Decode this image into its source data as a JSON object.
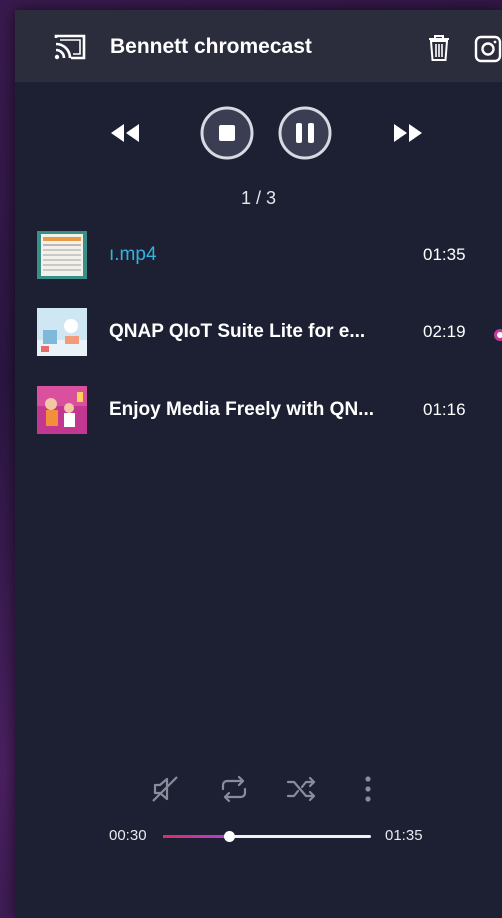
{
  "header": {
    "device_name": "Bennett chromecast",
    "icons": [
      "cast-icon",
      "trash-icon",
      "camera-icon"
    ]
  },
  "controls": {
    "icons": [
      "rewind-icon",
      "stop-icon",
      "pause-icon",
      "fast-forward-icon"
    ]
  },
  "playlist": {
    "counter": "1 / 3",
    "tracks": [
      {
        "title": "ı.mp4",
        "duration": "01:35",
        "active": true
      },
      {
        "title": "QNAP QIoT Suite Lite for e...",
        "duration": "02:19",
        "active": false
      },
      {
        "title": "Enjoy Media Freely with QN...",
        "duration": "01:16",
        "active": false
      }
    ]
  },
  "bottom_controls": {
    "icons": [
      "mute-icon",
      "repeat-icon",
      "shuffle-icon",
      "more-vertical-icon"
    ]
  },
  "progress": {
    "current_time": "00:30",
    "total_time": "01:35",
    "fraction": 0.316
  },
  "colors": {
    "accent_active_title": "#2fb6e0",
    "progress_start": "#d72f63",
    "progress_end": "#b23fd8",
    "panel_bg": "#1d2033",
    "header_bg": "#2b2d3c"
  }
}
